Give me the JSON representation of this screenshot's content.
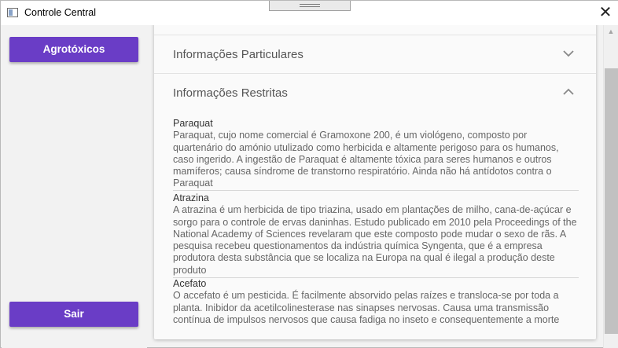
{
  "window": {
    "title": "Controle Central",
    "close_symbol": "✕"
  },
  "sidebar": {
    "top_button": "Agrotóxicos",
    "bottom_button": "Sair"
  },
  "panels": [
    {
      "label": "Informações Particulares",
      "expanded": false
    },
    {
      "label": "Informações Restritas",
      "expanded": true
    }
  ],
  "restricted_items": [
    {
      "name": "Paraquat",
      "description": "Paraquat, cujo nome comercial é Gramoxone 200, é um viológeno, composto por quartenário do amónio utulizado como herbicida e altamente perigoso para os humanos, caso ingerido. A ingestão de Paraquat é altamente tóxica para seres humanos e outros mamíferos; causa síndrome de transtorno respiratório. Ainda não há antídotos contra o Paraquat"
    },
    {
      "name": "Atrazina",
      "description": "A atrazina é um herbicida de tipo triazina, usado em plantações de milho, cana-de-açúcar e sorgo para o controle de ervas daninhas. Estudo publicado em 2010 pela Proceedings of the National Academy of Sciences revelaram que este composto pode mudar o sexo de rãs. A pesquisa recebeu questionamentos da indústria química Syngenta, que é a empresa produtora desta substância que se localiza na Europa na qual é ilegal a produção deste produto"
    },
    {
      "name": "Acefato",
      "description": "O accefato é um pesticida. É facilmente absorvido pelas raízes e transloca-se por toda a planta. Inibidor da acetilcolinesterase nas sinapses nervosas. Causa uma transmissão contínua de impulsos nervosos que causa fadiga no inseto e consequentemente a morte"
    }
  ],
  "colors": {
    "accent": "#6a3dc6",
    "background": "#f2f2f2",
    "panel": "#fafafa"
  },
  "icons": {
    "app": "window-icon",
    "collapsed": "chevron-down-icon",
    "expanded": "chevron-up-icon"
  }
}
